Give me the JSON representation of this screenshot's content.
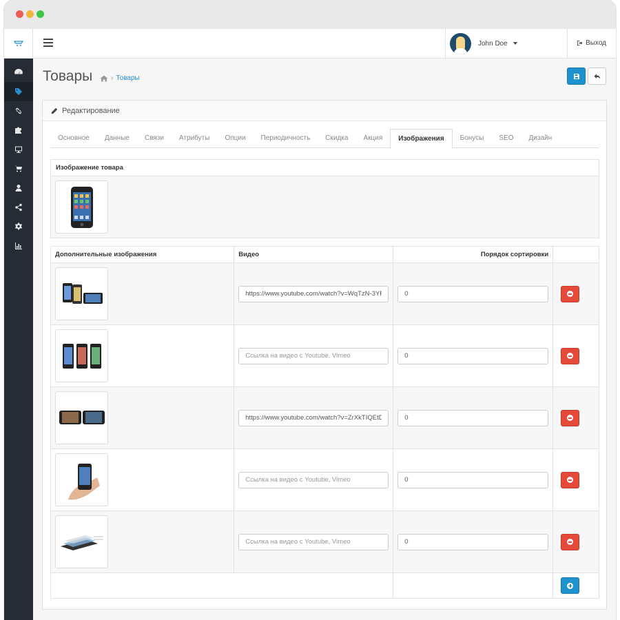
{
  "header": {
    "user_name": "John Doe",
    "logout_label": "Выход"
  },
  "sidebar": {
    "items": [
      {
        "icon": "dashboard-icon"
      },
      {
        "icon": "tag-icon",
        "active": true
      },
      {
        "icon": "link-icon"
      },
      {
        "icon": "puzzle-icon"
      },
      {
        "icon": "monitor-icon"
      },
      {
        "icon": "cart-icon"
      },
      {
        "icon": "user-icon"
      },
      {
        "icon": "share-icon"
      },
      {
        "icon": "gear-icon"
      },
      {
        "icon": "bar-chart-icon"
      }
    ]
  },
  "page": {
    "title": "Товары",
    "breadcrumb": "Товары",
    "panel_heading": "Редактирование"
  },
  "tabs": [
    "Основное",
    "Данные",
    "Связи",
    "Атрибуты",
    "Опции",
    "Периодичность",
    "Скидка",
    "Акция",
    "Изображения",
    "Бонусы",
    "SEO",
    "Дизайн"
  ],
  "active_tab": "Изображения",
  "main_image": {
    "header": "Изображение товара"
  },
  "additional": {
    "headers": {
      "image": "Дополнительные изображения",
      "video": "Видео",
      "sort": "Порядок сортировки"
    },
    "video_placeholder": "Ссылка на видео с Youtube, Vimeo",
    "rows": [
      {
        "video": "https://www.youtube.com/watch?v=WqTzN-3YF",
        "sort": "0"
      },
      {
        "video": "",
        "sort": "0"
      },
      {
        "video": "https://www.youtube.com/watch?v=ZrXkTIQEtD",
        "sort": "0"
      },
      {
        "video": "",
        "sort": "0"
      },
      {
        "video": "",
        "sort": "0"
      }
    ]
  },
  "colors": {
    "primary": "#1e91cf",
    "danger": "#e5493a",
    "sidebar": "#252c33"
  }
}
